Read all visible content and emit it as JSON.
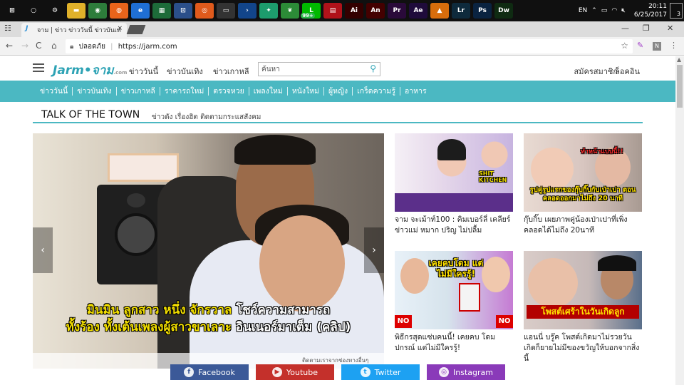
{
  "taskbar": {
    "lang": "EN",
    "time": "20:11",
    "date": "6/25/2017",
    "badge": "99+",
    "notif_count": "3",
    "app_icons": [
      {
        "name": "windows-icon",
        "glyph": "⊞",
        "bg": "#101010"
      },
      {
        "name": "cortana-icon",
        "glyph": "○",
        "bg": "#101010"
      },
      {
        "name": "settings-gear-icon",
        "glyph": "⚙",
        "bg": "#101010"
      },
      {
        "name": "file-explorer-icon",
        "glyph": "▬",
        "bg": "#e0b12a"
      },
      {
        "name": "chrome-icon",
        "glyph": "◉",
        "bg": "#2d7d3b"
      },
      {
        "name": "firefox-icon",
        "glyph": "◍",
        "bg": "#e8641b"
      },
      {
        "name": "edge-icon",
        "glyph": "e",
        "bg": "#1f6fd4"
      },
      {
        "name": "spreadsheet-icon",
        "glyph": "▦",
        "bg": "#1d6b39"
      },
      {
        "name": "network-icon",
        "glyph": "⊡",
        "bg": "#2b4f8a"
      },
      {
        "name": "ubuntu-icon",
        "glyph": "◎",
        "bg": "#e05a1c"
      },
      {
        "name": "terminal-icon",
        "glyph": "▭",
        "bg": "#333"
      },
      {
        "name": "powershell-icon",
        "glyph": "›",
        "bg": "#12458a"
      },
      {
        "name": "gitkraken-icon",
        "glyph": "✦",
        "bg": "#1d9c6d"
      },
      {
        "name": "mongodb-icon",
        "glyph": "❦",
        "bg": "#2c8b37"
      },
      {
        "name": "line-icon",
        "glyph": "L",
        "bg": "#00b900"
      },
      {
        "name": "rar-icon",
        "glyph": "▤",
        "bg": "#b0121a"
      },
      {
        "name": "illustrator-icon",
        "glyph": "Ai",
        "bg": "#300"
      },
      {
        "name": "animate-icon",
        "glyph": "An",
        "bg": "#400"
      },
      {
        "name": "premiere-icon",
        "glyph": "Pr",
        "bg": "#2a0a3a"
      },
      {
        "name": "after-effects-icon",
        "glyph": "Ae",
        "bg": "#1f0b3b"
      },
      {
        "name": "vlc-icon",
        "glyph": "▲",
        "bg": "#d86d0c"
      },
      {
        "name": "lightroom-icon",
        "glyph": "Lr",
        "bg": "#0e2a3c"
      },
      {
        "name": "photoshop-icon",
        "glyph": "Ps",
        "bg": "#0a2340"
      },
      {
        "name": "dreamweaver-icon",
        "glyph": "Dw",
        "bg": "#0f2b12"
      }
    ]
  },
  "browser": {
    "tab_title": "จาม | ข่าว ข่าววันนี้ ข่าวบันเท",
    "tab_favicon": "J",
    "tab_close": "×",
    "back": "←",
    "forward": "→",
    "reload": "C",
    "home": "⌂",
    "secure_label": "ปลอดภัย",
    "url": "https://jarm.com",
    "win_min": "—",
    "win_restore": "❐",
    "win_close": "✕",
    "star": "☆",
    "ext1": "✎",
    "ext2": "N",
    "menu": "⋮"
  },
  "site": {
    "logo": "Jarm•จาม",
    "logo_suffix": ".com",
    "topnav": [
      "ข่าววันนี้",
      "ข่าวบันเทิง",
      "ข่าวเกาหลี"
    ],
    "search_placeholder": "ค้นหา",
    "register": "สมัครสมาชิก",
    "login": "ล็อคอิน",
    "categories": [
      "ข่าววันนี้",
      "ข่าวบันเทิง",
      "ข่าวเกาหลี",
      "ราคารถใหม่",
      "ตรวจหวย",
      "เพลงใหม่",
      "หนังใหม่",
      "ผู้หญิง",
      "เกร็ดความรู้",
      "อาหาร"
    ],
    "section_title": "TALK OF THE TOWN",
    "section_sub": "ข่าวดัง เรื่องฮิต ติดตามกระแสสังคม",
    "hero_line1_a": "มินมิน ลูกสาว หนึ่ง",
    "hero_line1_b": "จักรวาล",
    "hero_line1_c": "โชว์ความสามารถ",
    "hero_line2_a": "ทั้งร้อง ทั้งเต้นเพลงผู้สาวขาเลาะ",
    "hero_line2_b": "อินเนอร์มาเต็ม (คลิป)",
    "hero_footer": "ติดตามเราจากช่องทางอื่นๆ",
    "cards": [
      {
        "title": "จาม จะเม้าท์100 : คิมเบอร์ลี่ เคลียร์ข่าวแม่ หมาก ปริญ ไม่ปลื้ม",
        "overlay": "SHIT KITCHEN"
      },
      {
        "title": "กุ๊บกิ๊บ เผยภาพคู่น้องเป่าเปาที่เพิ่งคลอดได้ไม่ถึง 20นาที",
        "overlay": "ทำหน้าแบบนี้!!",
        "overlay2": "รูปคู่รูปแรกของกุ๊บกิ๊บกับเป่าเปา ตอนคลอดออกมาไม่ถึง 20 นาที"
      },
      {
        "title": "พิธีกรสุดแซ่บคนนี้! เคยคบ โดม ปกรณ์ แต่ไม่มีใครรู้!",
        "overlay": "เคยคบโดม แต่ไม่มีใครรู้!",
        "no1": "NO",
        "no2": "NO"
      },
      {
        "title": "แอนนี่ บรู๊ค โพสต์เกิดมาไม่รวยวันเกิดก็ยายไม่มีของขวัญให้บอกจากสิ่งนี้",
        "overlay": "โพสต์เศร้าในวันเกิดลูก"
      }
    ]
  },
  "social": [
    {
      "label": "Facebook",
      "glyph": "f",
      "color": "#3b5998"
    },
    {
      "label": "Youtube",
      "glyph": "▶",
      "color": "#c4302b"
    },
    {
      "label": "Twitter",
      "glyph": "t",
      "color": "#1da1f2"
    },
    {
      "label": "Instagram",
      "glyph": "◎",
      "color": "#8a3ab9"
    }
  ]
}
